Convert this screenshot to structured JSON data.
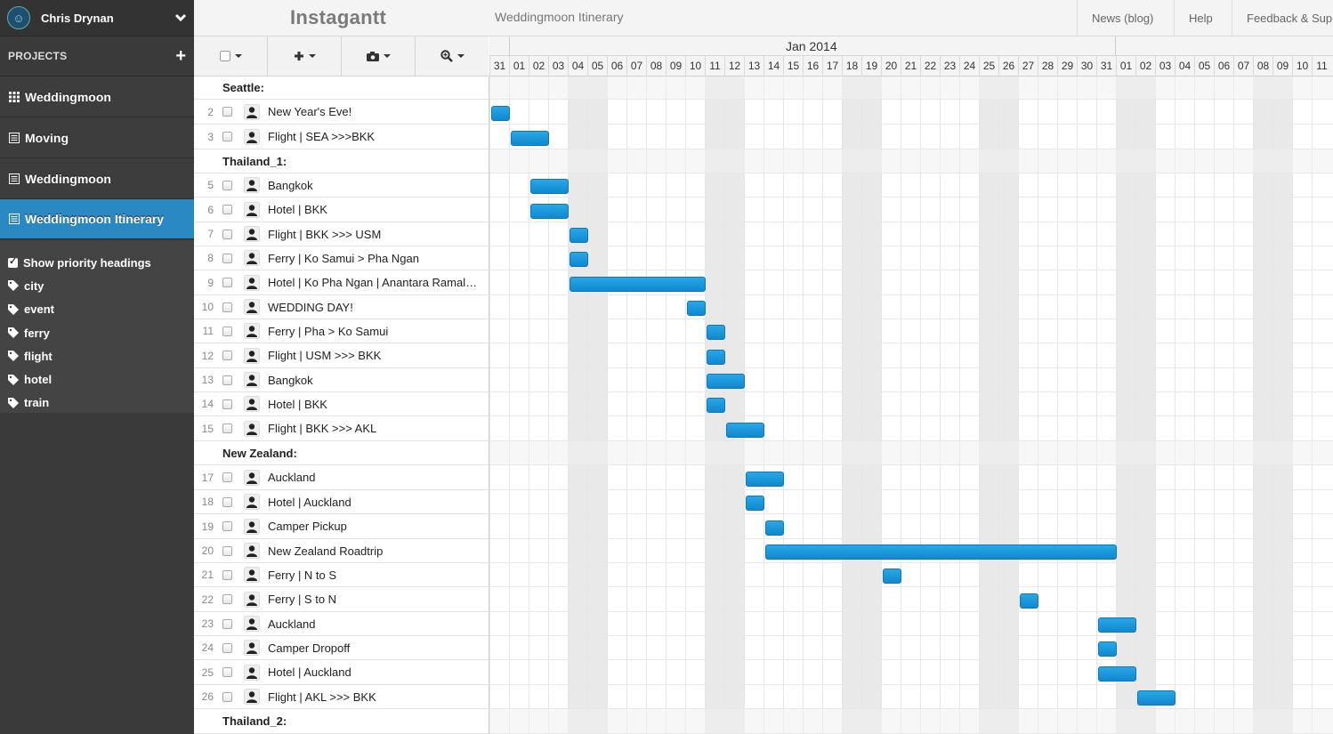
{
  "user": {
    "name": "Chris Drynan"
  },
  "sidebar": {
    "projects_label": "PROJECTS",
    "projects": [
      {
        "label": "Weddingmoon",
        "icon": "grid-icon",
        "active": false
      },
      {
        "label": "Moving",
        "icon": "list-icon",
        "active": false
      },
      {
        "label": "Weddingmoon",
        "icon": "list-icon",
        "active": false
      },
      {
        "label": "Weddingmoon Itinerary",
        "icon": "list-icon",
        "active": true
      }
    ],
    "show_priority": "Show priority headings",
    "tags": [
      "city",
      "event",
      "ferry",
      "flight",
      "hotel",
      "train"
    ]
  },
  "topbar": {
    "brand": "Instagantt",
    "project_title": "Weddingmoon Itinerary",
    "nav": [
      "News (blog)",
      "Help",
      "Feedback & Sup"
    ]
  },
  "toolbar": {
    "buttons": [
      "checkbox-menu",
      "add-menu",
      "camera-menu",
      "zoom-menu"
    ]
  },
  "gantt": {
    "month": "Jan 2014",
    "days": [
      "31",
      "01",
      "02",
      "03",
      "04",
      "05",
      "06",
      "07",
      "08",
      "09",
      "10",
      "11",
      "12",
      "13",
      "14",
      "15",
      "16",
      "17",
      "18",
      "19",
      "20",
      "21",
      "22",
      "23",
      "24",
      "25",
      "26",
      "27",
      "28",
      "29",
      "30",
      "31",
      "01",
      "02",
      "03",
      "04",
      "05",
      "06",
      "07",
      "08",
      "09",
      "10",
      "11"
    ],
    "weekend_days": [
      4,
      5,
      11,
      12,
      18,
      19,
      25,
      26,
      32,
      33,
      39,
      40
    ]
  },
  "rows": [
    {
      "type": "heading",
      "name": "Seattle:"
    },
    {
      "type": "task",
      "num": "2",
      "name": "New Year's Eve!",
      "start": 0,
      "dur": 1
    },
    {
      "type": "task",
      "num": "3",
      "name": "Flight | SEA >>>BKK",
      "start": 1,
      "dur": 2
    },
    {
      "type": "heading",
      "name": "Thailand_1:"
    },
    {
      "type": "task",
      "num": "5",
      "name": "Bangkok",
      "start": 2,
      "dur": 2
    },
    {
      "type": "task",
      "num": "6",
      "name": "Hotel | BKK",
      "start": 2,
      "dur": 2
    },
    {
      "type": "task",
      "num": "7",
      "name": "Flight | BKK >>> USM",
      "start": 4,
      "dur": 1
    },
    {
      "type": "task",
      "num": "8",
      "name": "Ferry | Ko Samui > Pha Ngan",
      "start": 4,
      "dur": 1
    },
    {
      "type": "task",
      "num": "9",
      "name": "Hotel | Ko Pha Ngan | Anantara Ramal…",
      "start": 4,
      "dur": 7
    },
    {
      "type": "task",
      "num": "10",
      "name": "WEDDING DAY!",
      "start": 10,
      "dur": 1
    },
    {
      "type": "task",
      "num": "11",
      "name": "Ferry | Pha  > Ko Samui",
      "start": 11,
      "dur": 1
    },
    {
      "type": "task",
      "num": "12",
      "name": "Flight | USM >>> BKK",
      "start": 11,
      "dur": 1
    },
    {
      "type": "task",
      "num": "13",
      "name": "Bangkok",
      "start": 11,
      "dur": 2
    },
    {
      "type": "task",
      "num": "14",
      "name": "Hotel | BKK",
      "start": 11,
      "dur": 1
    },
    {
      "type": "task",
      "num": "15",
      "name": "Flight | BKK >>> AKL",
      "start": 12,
      "dur": 2
    },
    {
      "type": "heading",
      "name": "New Zealand:"
    },
    {
      "type": "task",
      "num": "17",
      "name": "Auckland",
      "start": 13,
      "dur": 2
    },
    {
      "type": "task",
      "num": "18",
      "name": "Hotel | Auckland",
      "start": 13,
      "dur": 1
    },
    {
      "type": "task",
      "num": "19",
      "name": "Camper Pickup",
      "start": 14,
      "dur": 1
    },
    {
      "type": "task",
      "num": "20",
      "name": "New Zealand Roadtrip",
      "start": 14,
      "dur": 18
    },
    {
      "type": "task",
      "num": "21",
      "name": "Ferry | N to S",
      "start": 20,
      "dur": 1
    },
    {
      "type": "task",
      "num": "22",
      "name": "Ferry | S to N",
      "start": 27,
      "dur": 1
    },
    {
      "type": "task",
      "num": "23",
      "name": "Auckland",
      "start": 31,
      "dur": 2
    },
    {
      "type": "task",
      "num": "24",
      "name": "Camper Dropoff",
      "start": 31,
      "dur": 1
    },
    {
      "type": "task",
      "num": "25",
      "name": "Hotel | Auckland",
      "start": 31,
      "dur": 2
    },
    {
      "type": "task",
      "num": "26",
      "name": "Flight | AKL >>> BKK",
      "start": 33,
      "dur": 2
    },
    {
      "type": "heading",
      "name": "Thailand_2:"
    }
  ],
  "colors": {
    "accent": "#2a88c2",
    "bar": "#1a96d8",
    "sidebar": "#3a3a3a"
  }
}
